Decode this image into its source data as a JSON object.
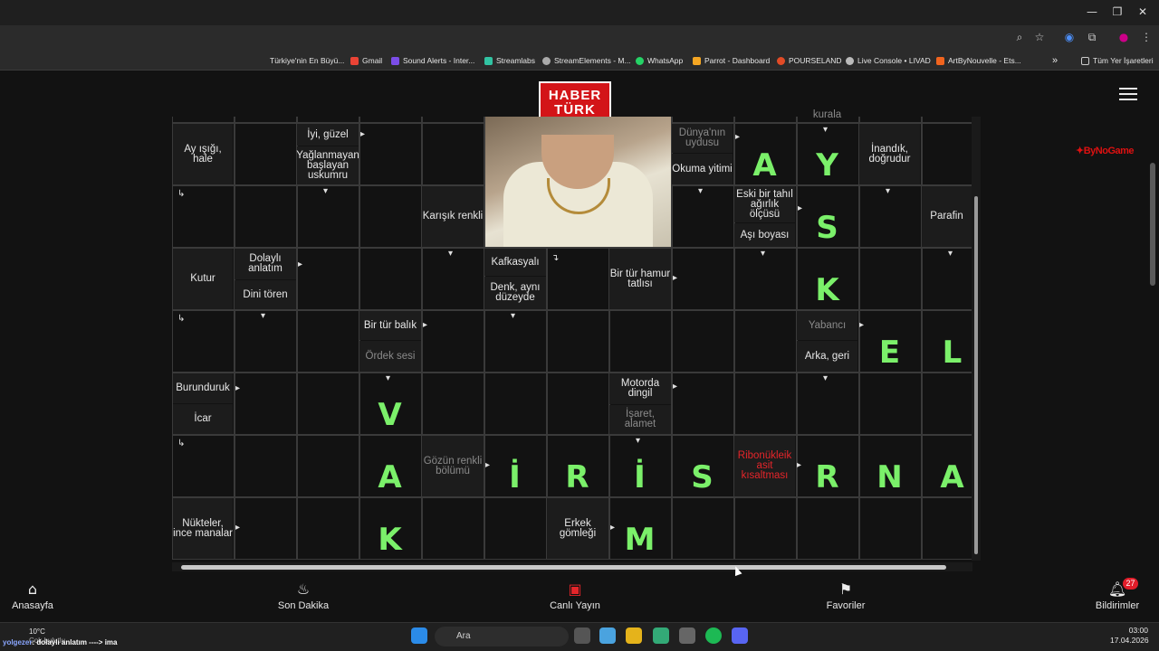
{
  "bookmarks": [
    "Türkiye'nin En Büyü...",
    "Gmail",
    "Sound Alerts - Inter...",
    "Streamlabs",
    "StreamElements - M...",
    "WhatsApp",
    "Parrot - Dashboard",
    "POURSELAND",
    "Live Console • LIVAD",
    "ArtByNouvelle - Ets..."
  ],
  "all_bookmarks": "Tüm Yer İşaretleri",
  "more_bookmarks": "»",
  "logo": {
    "line1": "HABER",
    "line2": "TÜRK"
  },
  "ad_logo": "ByNoGame",
  "clues": {
    "ay_isigi": "Ay ışığı, hale",
    "iyi_guzel": "İyi, güzel",
    "yaglanmayan": "Yağlanmayan başlayan uskumru",
    "dunya_uydusu": "Dünya'nın uydusu",
    "okuma_yitimi": "Okuma yitimi",
    "kurala": "kurala",
    "inandik": "İnandık, doğrudur",
    "karisik": "Karışık renkli",
    "eski_tahil": "Eski bir tahıl ağırlık ölçüsü",
    "asi_boyasi": "Aşı boyası",
    "parafin": "Parafin",
    "kutur": "Kutur",
    "dolayli": "Dolaylı anlatım",
    "dini_toren": "Dini tören",
    "kafkasyali": "Kafkasyalı",
    "denk": "Denk, aynı düzeyde",
    "hamur_tatlisi": "Bir tür hamur tatlısı",
    "balik": "Bir tür balık",
    "ordek_sesi": "Ördek sesi",
    "yabanci": "Yabancı",
    "arka_geri": "Arka, geri",
    "burunduruk": "Burunduruk",
    "icar": "İcar",
    "motorda_dingil": "Motorda dingil",
    "isaret": "İşaret, alamet",
    "gozun_renkli": "Gözün renkli bölümü",
    "ribonukleik": "Ribonükleik asit kısaltması",
    "nukteler": "Nükteler, ince manalar",
    "erkek_gomlegi": "Erkek gömleği"
  },
  "answers": {
    "a1": "A",
    "y1": "Y",
    "s1": "S",
    "k1": "K",
    "e1": "E",
    "l1": "L",
    "v1": "V",
    "a2": "A",
    "i1": "İ",
    "r1": "R",
    "i2": "İ",
    "s2": "S",
    "r2": "R",
    "n1": "N",
    "a3": "A",
    "k2": "K",
    "m1": "M"
  },
  "nav": {
    "home": "Anasayfa",
    "breaking": "Son Dakika",
    "live": "Canlı Yayın",
    "favs": "Favoriler",
    "notif": "Bildirimler",
    "badge": "27"
  },
  "taskbar": {
    "search": "Ara",
    "temp": "10°C",
    "weather_sub": "Çok bulutlu",
    "time": "03:00",
    "date": "17.04.2026"
  },
  "chat": {
    "user": "yolgezer",
    "msg": ": dolaylı anlatım ----> ima"
  },
  "colors": {
    "answer": "#7bf06a",
    "brand": "#d31418",
    "clue_red": "#e5252a"
  }
}
